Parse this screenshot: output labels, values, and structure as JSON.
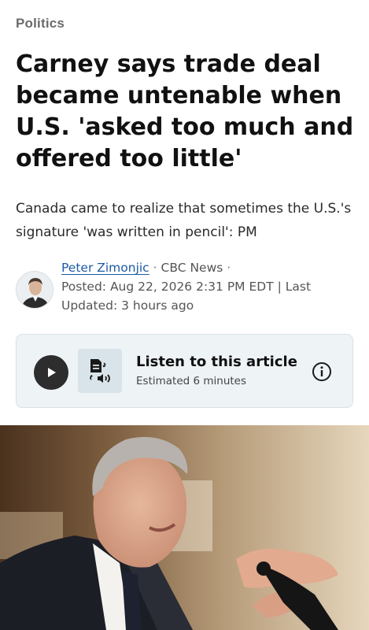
{
  "article": {
    "category": "Politics",
    "headline": "Carney says trade deal became untenable when U.S. 'asked too much and offered too little'",
    "subheadline": "Canada came to realize that sometimes the U.S.'s signature 'was written in pencil': PM",
    "byline": {
      "author": "Peter Zimonjic",
      "separator": "·",
      "outlet": "CBC News",
      "posted": "Posted: Aug 22, 2026 2:31 PM EDT | Last Updated: 3 hours ago"
    }
  },
  "listen": {
    "title": "Listen to this article",
    "duration": "Estimated 6 minutes"
  },
  "icons": {
    "play": "play-icon",
    "tts": "text-to-speech-icon",
    "info": "info-icon"
  },
  "colors": {
    "author_link": "#1d5aa5",
    "card_background": "#eef3f6",
    "play_button": "#2d2d2d"
  }
}
